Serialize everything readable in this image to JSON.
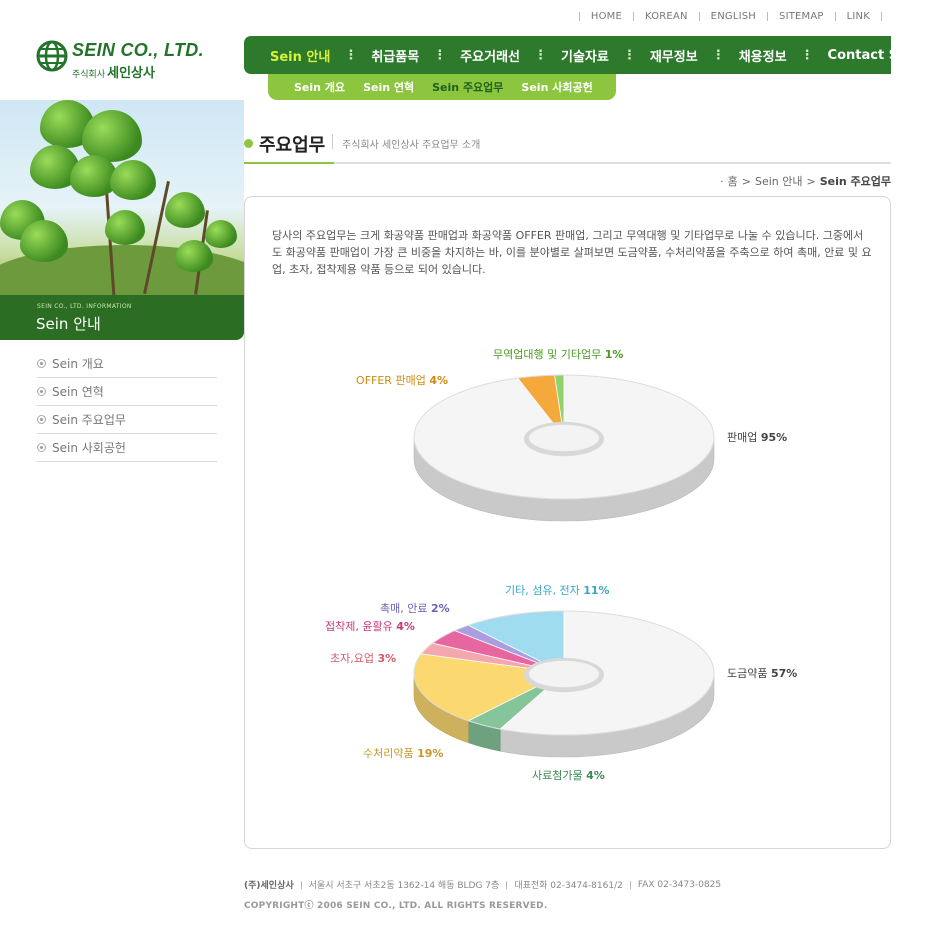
{
  "toplinks": [
    "HOME",
    "KOREAN",
    "ENGLISH",
    "SITEMAP",
    "LINK"
  ],
  "logo": {
    "name": "SEIN CO., LTD.",
    "prefix": "주식회사",
    "korean": "세인상사"
  },
  "nav": {
    "items": [
      "Sein 안내",
      "취급품목",
      "주요거래선",
      "기술자료",
      "재무정보",
      "채용정보",
      "Contact Sein"
    ],
    "active_index": 0
  },
  "subnav": {
    "items": [
      "Sein 개요",
      "Sein 연혁",
      "Sein 주요업무",
      "Sein 사회공헌"
    ],
    "active_index": 2
  },
  "section": {
    "small": "SEIN CO., LTD. INFORMATION",
    "title": "Sein 안내"
  },
  "lnb": [
    "Sein 개요",
    "Sein 연혁",
    "Sein 주요업무",
    "Sein 사회공헌"
  ],
  "page": {
    "title": "주요업무",
    "description": "주식회사 세인상사 주요업무 소개",
    "breadcrumb": {
      "home": "홈",
      "parent": "Sein 안내",
      "current": "Sein 주요업무"
    },
    "intro": "당사의 주요업무는 크게 화공약품 판매업과 화공약품 OFFER 판매업, 그리고 무역대행 및 기타업무로 나눌 수 있습니다. 그중에서도 화공약품 판매업이 가장 큰 비중을 차지하는 바, 이를 분야별로 살펴보면 도금약품, 수처리약품을 주축으로 하여 촉매, 안료 및 요업, 초자, 접착제용 약품 등으로 되어 있습니다."
  },
  "chart_data": [
    {
      "type": "pie",
      "slices": [
        {
          "label": "판매업",
          "value": 95,
          "color": "#f5f5f5",
          "label_color": "#444444"
        },
        {
          "label": "OFFER 판매업",
          "value": 4,
          "color": "#f5a83c",
          "label_color": "#d08a10"
        },
        {
          "label": "무역업대행 및 기타업무",
          "value": 1,
          "color": "#8fd46a",
          "label_color": "#4a9a22"
        }
      ]
    },
    {
      "type": "pie",
      "slices": [
        {
          "label": "도금약품",
          "value": 57,
          "color": "#f5f5f5",
          "label_color": "#444444"
        },
        {
          "label": "사료첨가물",
          "value": 4,
          "color": "#86c49a",
          "label_color": "#3a8a55"
        },
        {
          "label": "수처리약품",
          "value": 19,
          "color": "#fbd870",
          "label_color": "#c8962a"
        },
        {
          "label": "초자,요업",
          "value": 3,
          "color": "#f4a7ae",
          "label_color": "#d85a6a"
        },
        {
          "label": "접착제, 윤활유",
          "value": 4,
          "color": "#e866a0",
          "label_color": "#c83a7a"
        },
        {
          "label": "촉매, 안료",
          "value": 2,
          "color": "#a89ee0",
          "label_color": "#6a64b8"
        },
        {
          "label": "기타, 섬유, 전자",
          "value": 11,
          "color": "#9fdcf0",
          "label_color": "#3aa6c6"
        }
      ]
    }
  ],
  "footer": {
    "company": "(주)세인상사",
    "address": "서울시 서초구 서초2동 1362-14 해동 BLDG 7층",
    "tel": "대표전화  02-3474-8161/2",
    "fax": "FAX  02-3473-0825",
    "copyright": "COPYRIGHTⓒ 2006 SEIN CO., LTD. ALL RIGHTS RESERVED."
  },
  "colors": {
    "brand_green": "#2d7a2c",
    "light_green": "#8cc63f",
    "active_yellow": "#d7f23a"
  }
}
